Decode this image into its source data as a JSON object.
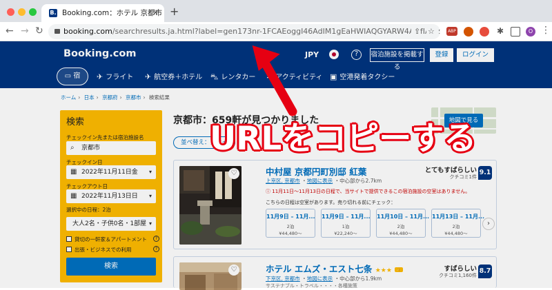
{
  "browser": {
    "tab_title": "Booking.com：ホテル 京都市 -",
    "tab_favicon": "B.",
    "url_host": "booking.com",
    "url_rest": "/searchresults.ja.html?label=gen173nr-1FCAEoggI46AdIM1gEaHWIAQGYARW4AQfIAQzY...",
    "profile_initial": "O",
    "extension_label": "ABP"
  },
  "header": {
    "logo": "Booking.com",
    "currency": "JPY",
    "help_symbol": "?",
    "list_property": "宿泊施設を掲載する",
    "register": "登録",
    "login": "ログイン",
    "nav": {
      "stays": "宿",
      "flights": "フライト",
      "flight_hotel": "航空券＋ホテル",
      "car_rental": "レンタカー",
      "activities": "アクティビティ",
      "airport_taxi": "空港発着タクシー"
    }
  },
  "breadcrumb": [
    "ホーム",
    "日本",
    "京都府",
    "京都市",
    "検索結果"
  ],
  "search": {
    "title": "検索",
    "destination_label": "チェックイン先または宿泊施設名",
    "destination_value": "京都市",
    "checkin_label": "チェックイン日",
    "checkin_value": "2022年11月11日金",
    "checkout_label": "チェックアウト日",
    "checkout_value": "2022年11月13日日",
    "stay_length": "選択中の日程：2泊",
    "guests_value": "大人2名・子供0名・1部屋",
    "check_entire": "貸切の一軒家＆アパートメント",
    "check_business": "出張・ビジネスでの利用",
    "button": "検索"
  },
  "results": {
    "heading": "京都市：659軒が見つかりました",
    "sort_label": "並べ替え：当サイトおすすめ",
    "map_button": "地図で見る"
  },
  "cards": [
    {
      "name": "中村屋 京都円町別邸 紅葉",
      "location_area": "上京区, 京都市",
      "location_map": "地図に表示",
      "location_dist": "中心部から2.7km",
      "score_label": "とてもすばらしい",
      "score_sub": "クチコミ1件",
      "score": "9.1",
      "alert": "11月11日～11月13日の日程で、当サイトで提供できるこの宿泊施設の空室はありません。",
      "note": "こちらの日程は空室があります。売り切れる前にチェック：",
      "dates": [
        {
          "range": "11月9日 – 11月...",
          "nights": "2泊",
          "price": "¥44,480～"
        },
        {
          "range": "11月9日 – 11月...",
          "nights": "1泊",
          "price": "¥22,240～"
        },
        {
          "range": "11月10日 – 11月...",
          "nights": "2泊",
          "price": "¥44,480～"
        },
        {
          "range": "11月13日 – 11月...",
          "nights": "2泊",
          "price": "¥44,480～"
        }
      ]
    },
    {
      "name": "ホテル エムズ・エスト七条",
      "stars": "★★★",
      "location_area": "下京区, 京都市",
      "location_map": "地図に表示",
      "location_dist": "中心部から1.9km",
      "score_label": "すばらしい",
      "score_sub": "クチコミ1,160件",
      "score": "8.7",
      "extra": "サステナブル・トラベル・・・・各種施策"
    }
  ],
  "overlay": {
    "caption": "URLをコピーする",
    "color": "#e60012"
  },
  "colors": {
    "brand": "#003580",
    "accent": "#0071c2",
    "search_panel": "#febb02"
  }
}
